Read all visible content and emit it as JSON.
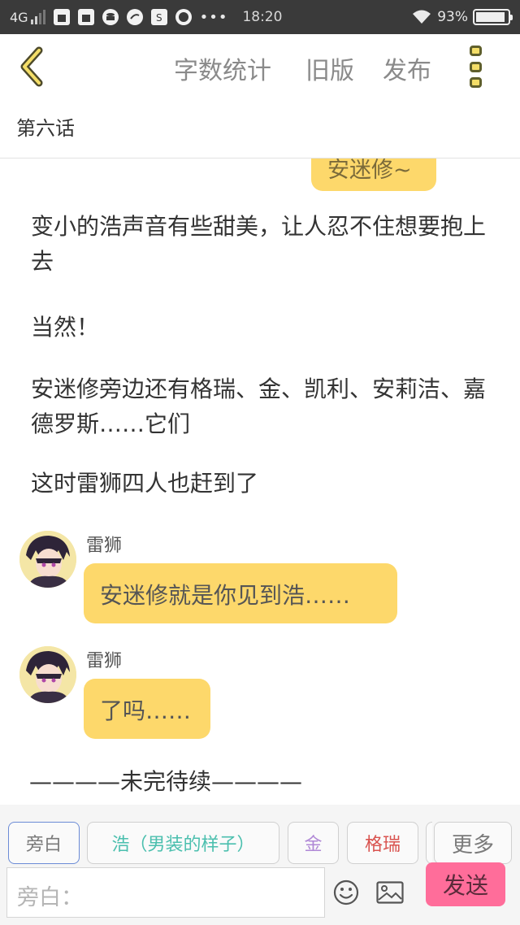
{
  "status_bar": {
    "network": "4G",
    "time": "18:20",
    "battery_percent": "93%",
    "battery_level": 0.93,
    "more_dots": "•••"
  },
  "header": {
    "word_count": "字数统计",
    "old_version": "旧版",
    "publish": "发布"
  },
  "chapter_title": "第六话",
  "content": {
    "top_bubble": "安迷修~",
    "paragraphs": [
      "变小的浩声音有些甜美，让人忍不住想要抱上去",
      "当然！",
      "安迷修旁边还有格瑞、金、凯利、安莉洁、嘉德罗斯……它们",
      "这时雷狮四人也赶到了"
    ],
    "messages": [
      {
        "speaker": "雷狮",
        "text": "安迷修就是你见到浩……"
      },
      {
        "speaker": "雷狮",
        "text": "了吗……"
      }
    ],
    "to_be_continued": "————未完待续————"
  },
  "bottom_bar": {
    "chips": [
      {
        "label": "旁白",
        "color": "#7a7a7a"
      },
      {
        "label": "浩（男装的样子）",
        "color": "#4bbfae"
      },
      {
        "label": "金",
        "color": "#b088d6"
      },
      {
        "label": "格瑞",
        "color": "#d9534f"
      },
      {
        "label": "更多",
        "color": "#7a7a7a"
      }
    ],
    "input_placeholder": "旁白：",
    "send_label": "发送"
  },
  "colors": {
    "accent_yellow": "#fdd86b",
    "send_pink": "#ff6d9a",
    "status_bar_bg": "#3a3a3a"
  }
}
